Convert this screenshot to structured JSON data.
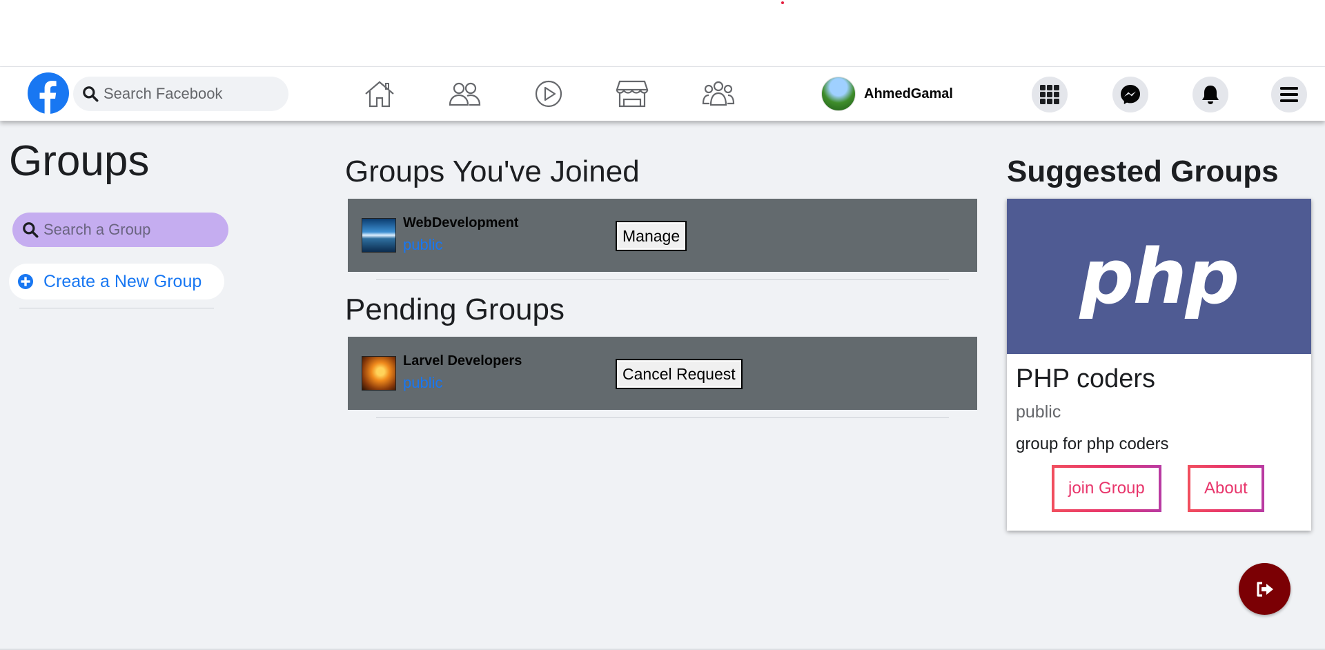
{
  "navbar": {
    "search_placeholder": "Search Facebook",
    "user_name": "AhmedGamal",
    "nav_icons": [
      "home-icon",
      "friends-icon",
      "watch-icon",
      "marketplace-icon",
      "groups-icon"
    ],
    "action_icons": [
      "menu-grid-icon",
      "messenger-icon",
      "bell-icon",
      "hamburger-icon"
    ],
    "brand_color": "#1877f2"
  },
  "sidebar": {
    "title": "Groups",
    "search_placeholder": "Search a Group",
    "create_label": "Create a New Group"
  },
  "main": {
    "joined_title": "Groups You've Joined",
    "joined": [
      {
        "name": "WebDevelopment",
        "privacy": "public",
        "action": "Manage"
      }
    ],
    "pending_title": "Pending Groups",
    "pending": [
      {
        "name": "Larvel Developers",
        "privacy": "public",
        "action": "Cancel Request"
      }
    ]
  },
  "suggested": {
    "title": "Suggested Groups",
    "logo_text": "php",
    "group_name": "PHP coders",
    "privacy": "public",
    "description": "group for php coders",
    "join_label": "join Group",
    "about_label": "About"
  },
  "logout": {
    "icon": "logout-icon",
    "color": "#7b0004"
  }
}
